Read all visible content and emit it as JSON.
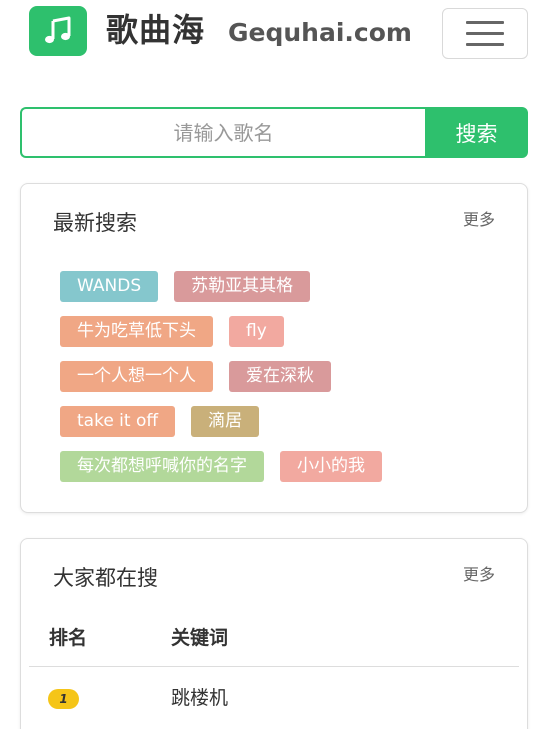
{
  "header": {
    "site_name": "歌曲海",
    "site_domain": "Gequhai.com",
    "logo_icon": "music-note-icon",
    "menu_icon": "hamburger-menu-icon"
  },
  "search": {
    "placeholder": "请输入歌名",
    "value": "",
    "button_label": "搜索"
  },
  "latest": {
    "title": "最新搜索",
    "more_label": "更多",
    "rows": [
      [
        {
          "label": "WANDS",
          "color": "#85c7cd"
        },
        {
          "label": "苏勒亚其其格",
          "color": "#d99a9b"
        }
      ],
      [
        {
          "label": "牛为吃草低下头",
          "color": "#f0a785"
        },
        {
          "label": "fly",
          "color": "#f2a9a0"
        }
      ],
      [
        {
          "label": "一个人想一个人",
          "color": "#f0a785"
        },
        {
          "label": "爱在深秋",
          "color": "#d99a9b"
        }
      ],
      [
        {
          "label": "take it off",
          "color": "#f0a785"
        },
        {
          "label": "滴居",
          "color": "#c9b07a"
        }
      ],
      [
        {
          "label": "每次都想呼喊你的名字",
          "color": "#b2d89a"
        },
        {
          "label": "小小的我",
          "color": "#f2a9a0"
        }
      ]
    ]
  },
  "hot": {
    "title": "大家都在搜",
    "more_label": "更多",
    "columns": [
      "排名",
      "关键词"
    ],
    "rows": [
      {
        "rank": "1",
        "keyword": "跳楼机"
      }
    ]
  },
  "colors": {
    "brand_green": "#2ec06d",
    "rank_badge": "#f5c518"
  }
}
